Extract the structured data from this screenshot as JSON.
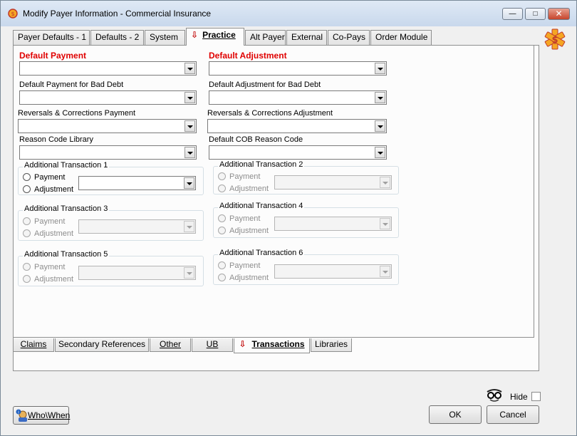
{
  "window": {
    "title": "Modify Payer Information - Commercial Insurance",
    "controls": [
      "minimize",
      "maximize",
      "close"
    ]
  },
  "top_tabs": [
    {
      "label": "Payer Defaults - 1",
      "underline_index": 0
    },
    {
      "label": "Defaults - 2",
      "underline_index": 0
    },
    {
      "label": "System",
      "underline_index": 0
    },
    {
      "label": "Practice",
      "active": true
    },
    {
      "label": "Alt Payer"
    },
    {
      "label": "External"
    },
    {
      "label": "Co-Pays"
    },
    {
      "label": "Order Module"
    }
  ],
  "fields": {
    "default_payment_label": "Default Payment",
    "default_adjustment_label": "Default Adjustment",
    "bad_debt_payment_label": "Default Payment for Bad Debt",
    "bad_debt_adjustment_label": "Default Adjustment for Bad Debt",
    "reversals_payment_label": "Reversals & Corrections Payment",
    "reversals_adjustment_label": "Reversals & Corrections Adjustment",
    "reason_code_library_label": "Reason Code Library",
    "default_cob_reason_label": "Default COB Reason Code"
  },
  "transactions": [
    {
      "title": "Additional Transaction 1",
      "payment": "Payment",
      "adjustment": "Adjustment",
      "enabled": true
    },
    {
      "title": "Additional Transaction 2",
      "payment": "Payment",
      "adjustment": "Adjustment",
      "enabled": false
    },
    {
      "title": "Additional Transaction 3",
      "payment": "Payment",
      "adjustment": "Adjustment",
      "enabled": false
    },
    {
      "title": "Additional Transaction 4",
      "payment": "Payment",
      "adjustment": "Adjustment",
      "enabled": false
    },
    {
      "title": "Additional Transaction 5",
      "payment": "Payment",
      "adjustment": "Adjustment",
      "enabled": false
    },
    {
      "title": "Additional Transaction 6",
      "payment": "Payment",
      "adjustment": "Adjustment",
      "enabled": false
    }
  ],
  "bottom_tabs": [
    {
      "label": "Claims"
    },
    {
      "label": "Secondary References"
    },
    {
      "label": "Other"
    },
    {
      "label": "UB"
    },
    {
      "label": "Transactions",
      "active": true
    },
    {
      "label": "Libraries"
    }
  ],
  "footer": {
    "hide_label": "Hide",
    "hide_checked": false,
    "who_when_label": "Who\\When",
    "ok_label": "OK",
    "cancel_label": "Cancel"
  },
  "colors": {
    "required_label": "#e00000",
    "active_tab_arrow": "#c00000"
  }
}
